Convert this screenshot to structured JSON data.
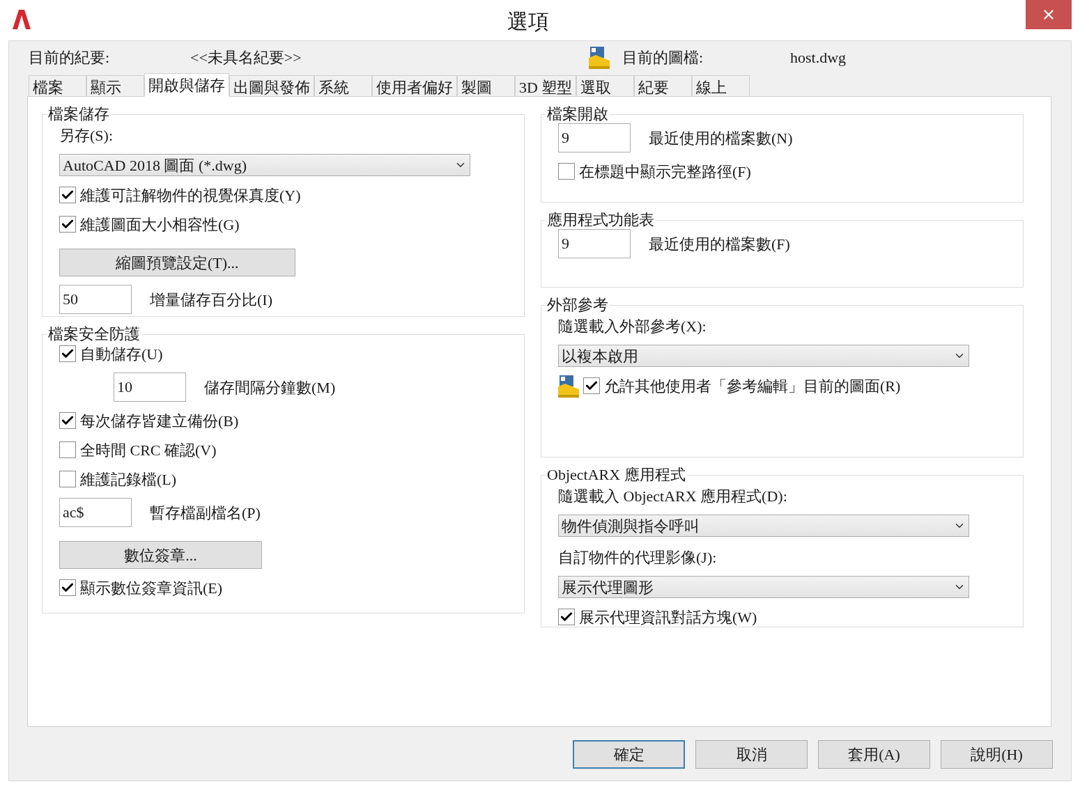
{
  "window": {
    "title": "選項"
  },
  "header": {
    "profile_label": "目前的紀要:",
    "profile_value": "<<未具名紀要>>",
    "drawing_label": "目前的圖檔:",
    "drawing_value": "host.dwg"
  },
  "tabs": [
    {
      "label": "檔案",
      "selected": false
    },
    {
      "label": "顯示",
      "selected": false
    },
    {
      "label": "開啟與儲存",
      "selected": true
    },
    {
      "label": "出圖與發佈",
      "selected": false
    },
    {
      "label": "系統",
      "selected": false
    },
    {
      "label": "使用者偏好",
      "selected": false
    },
    {
      "label": "製圖",
      "selected": false
    },
    {
      "label": "3D 塑型",
      "selected": false
    },
    {
      "label": "選取",
      "selected": false
    },
    {
      "label": "紀要",
      "selected": false
    },
    {
      "label": "線上",
      "selected": false
    }
  ],
  "columns": [
    [
      {
        "title": "檔案儲存",
        "items": [
          {
            "kind": "label",
            "text": "另存(S):"
          },
          {
            "kind": "select",
            "value": "AutoCAD 2018 圖面 (*.dwg)"
          },
          {
            "kind": "checkbox",
            "label": "維護可註解物件的視覺保真度(Y)",
            "checked": true
          },
          {
            "kind": "checkbox",
            "label": "維護圖面大小相容性(G)",
            "checked": true
          },
          {
            "kind": "button",
            "label": "縮圖預覽設定(T)..."
          },
          {
            "kind": "field",
            "value": "50",
            "caption": "增量儲存百分比(I)"
          }
        ]
      },
      {
        "title": "檔案安全防護",
        "items": [
          {
            "kind": "checkbox",
            "label": "自動儲存(U)",
            "checked": true
          },
          {
            "kind": "subfield",
            "value": "10",
            "caption": "儲存間隔分鐘數(M)"
          },
          {
            "kind": "checkbox",
            "label": "每次儲存皆建立備份(B)",
            "checked": true
          },
          {
            "kind": "checkbox",
            "label": "全時間 CRC 確認(V)",
            "checked": false
          },
          {
            "kind": "checkbox",
            "label": "維護記錄檔(L)",
            "checked": false
          },
          {
            "kind": "field",
            "value": "ac$",
            "caption": "暫存檔副檔名(P)"
          },
          {
            "kind": "button",
            "label": "數位簽章..."
          },
          {
            "kind": "checkbox",
            "label": "顯示數位簽章資訊(E)",
            "checked": true
          }
        ]
      }
    ],
    [
      {
        "title": "檔案開啟",
        "items": [
          {
            "kind": "field",
            "value": "9",
            "caption": "最近使用的檔案數(N)"
          },
          {
            "kind": "checkbox",
            "label": "在標題中顯示完整路徑(F)",
            "checked": false
          }
        ]
      },
      {
        "title": "應用程式功能表",
        "items": [
          {
            "kind": "field",
            "value": "9",
            "caption": "最近使用的檔案數(F)"
          }
        ]
      },
      {
        "title": "外部參考",
        "items": [
          {
            "kind": "label",
            "text": "隨選載入外部參考(X):"
          },
          {
            "kind": "select",
            "value": "以複本啟用"
          },
          {
            "kind": "iconcheck",
            "label": "允許其他使用者「參考編輯」目前的圖面(R)",
            "checked": true
          }
        ]
      },
      {
        "title": "ObjectARX 應用程式",
        "items": [
          {
            "kind": "label",
            "text": "隨選載入 ObjectARX 應用程式(D):"
          },
          {
            "kind": "select",
            "value": "物件偵測與指令呼叫"
          },
          {
            "kind": "label",
            "text": "自訂物件的代理影像(J):"
          },
          {
            "kind": "select",
            "value": "展示代理圖形"
          },
          {
            "kind": "checkbox",
            "label": "展示代理資訊對話方塊(W)",
            "checked": true
          }
        ]
      }
    ]
  ],
  "buttons": [
    {
      "label": "確定",
      "default": true
    },
    {
      "label": "取消",
      "default": false
    },
    {
      "label": "套用(A)",
      "default": false
    },
    {
      "label": "說明(H)",
      "default": false
    }
  ]
}
